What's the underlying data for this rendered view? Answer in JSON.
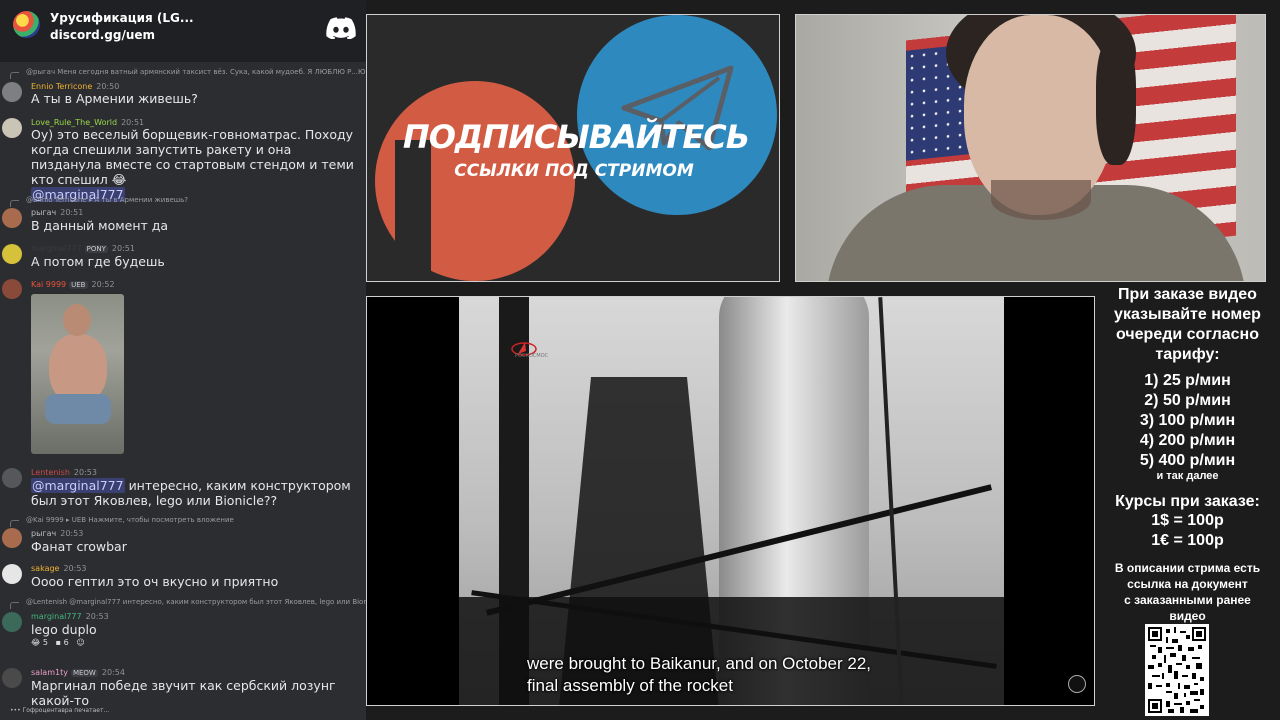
{
  "chat": {
    "server": {
      "name": "Урусификация (LG...",
      "invite": "discord.gg/uem"
    },
    "messages": [
      {
        "reply": "@рыгач Меня сегодня ватный армянский таксист вёз. Сука, какой мудоеб. Я ЛЮБЛЮ Р...Ю ЕСЛ...",
        "user": "Ennio Terricone",
        "user_color": "#f0b232",
        "badge": "",
        "time": "20:50",
        "text": "А ты в Армении живешь?"
      },
      {
        "reply": "",
        "user": "Love_Rule_The_World",
        "user_color": "#9ad84a",
        "badge": "",
        "time": "20:51",
        "text": "Оу) это веселый борщевик-говноматрас. Походу когда спешили запустить ракету и она пизданула вместе со стартовым стендом и теми кто спешил",
        "emoji": "😂",
        "mention": "@marginal777"
      },
      {
        "reply": "@Ennio Terricone ▸ А ты в Армении живешь?",
        "user": "рыгач",
        "user_color": "#b9bbbe",
        "badge": "",
        "time": "20:51",
        "text": "В данный момент да"
      },
      {
        "reply": "",
        "user": "marginal777",
        "user_color": "#2c2d30",
        "badge": "PONY",
        "time": "20:51",
        "text": "А потом где будешь"
      },
      {
        "reply": "",
        "user": "Kai 9999",
        "user_color": "#e8533d",
        "badge": "UEB",
        "time": "20:52",
        "text": ""
      },
      {
        "reply": "",
        "user": "Lentenish",
        "user_color": "#c84a4a",
        "badge": "",
        "time": "20:53",
        "mention": "@marginal777",
        "text": "интересно, каким конструктором был этот Яковлев, lego или Bionicle??"
      },
      {
        "reply": "@Kai 9999 ▸ UEB Нажмите, чтобы посмотреть вложение",
        "user": "рыгач",
        "user_color": "#b9bbbe",
        "badge": "",
        "time": "20:53",
        "text": "Фанат crowbar"
      },
      {
        "reply": "",
        "user": "sakage",
        "user_color": "#f0b232",
        "badge": "",
        "time": "20:53",
        "text": "Оооо гептил это оч вкусно и приятно"
      },
      {
        "reply": "@Lentenish @marginal777 интересно, каким конструктором был этот Яковлев, lego или Bionicle",
        "user": "marginal777",
        "user_color": "#43b581",
        "badge": "",
        "time": "20:53",
        "text": "lego duplo",
        "reactions": [
          "5",
          "6"
        ]
      },
      {
        "reply": "",
        "user": "salam1ty",
        "user_color": "#e8a1c8",
        "badge": "MEOW",
        "time": "20:54",
        "text": "Маргинал победе звучит как сербский лозунг какой-то"
      }
    ],
    "typing": "Гофроцентавра печатает..."
  },
  "promo": {
    "title": "ПОДПИСЫВАЙТЕСЬ",
    "subtitle": "ССЫЛКИ ПОД СТРИМОМ"
  },
  "video": {
    "subtitle_line1": "were brought to Baikanur, and on October 22,",
    "subtitle_line2": "final assembly of the rocket",
    "logo_text": "РОСКОСМОС"
  },
  "info": {
    "heading": [
      "При заказе видео",
      "указывайте номер",
      "очереди согласно",
      "тарифу:"
    ],
    "tariffs": [
      "1) 25 р/мин",
      "2) 50 р/мин",
      "3) 100 р/мин",
      "4) 200 р/мин",
      "5) 400 р/мин"
    ],
    "tariff_more": "и так далее",
    "rates_heading": "Курсы при заказе:",
    "rates": [
      "1$ = 100р",
      "1€ = 100р"
    ],
    "description_note": [
      "В описании стрима есть",
      "ссылка на документ",
      "с заказанными ранее",
      "видео"
    ]
  },
  "colors": {
    "chat_bg": "#2c2d30",
    "mention_bg": "#5865f2",
    "patreon": "#f06448",
    "telegram": "#2f9ad9",
    "page_bg": "#1c1c1c"
  },
  "icons": [
    "discord-icon",
    "server-icon",
    "roscosmos-icon",
    "telegram-plane-icon",
    "qr-code",
    "watermark-icon"
  ]
}
